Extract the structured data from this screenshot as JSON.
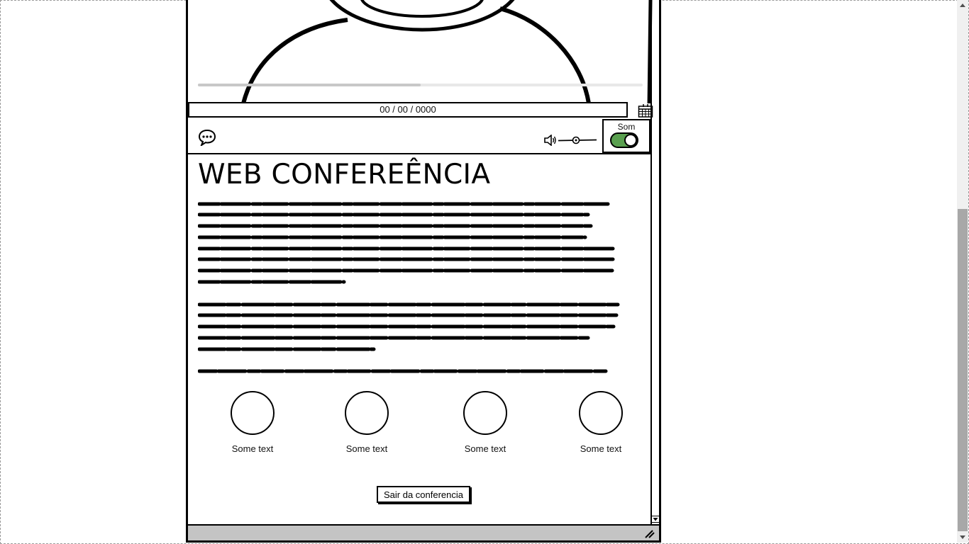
{
  "video": {
    "progress_fraction": 0.5
  },
  "date_field": {
    "value": "00  / 00 / 0000"
  },
  "toolbar": {
    "chat_icon": "speech-bubble-icon",
    "volume_icon": "speaker-icon",
    "sound_label": "Som",
    "sound_on": true
  },
  "main": {
    "title": "WEB CONFEREÊNCIA",
    "participants": [
      {
        "label": "Some text"
      },
      {
        "label": "Some text"
      },
      {
        "label": "Some text"
      },
      {
        "label": "Some text"
      }
    ],
    "exit_button": "Sair da conferencia"
  },
  "colors": {
    "toggle_on": "#5aa050",
    "scrollbar_thumb": "#a8a8a8",
    "footer_bar": "#c4c4c4"
  }
}
